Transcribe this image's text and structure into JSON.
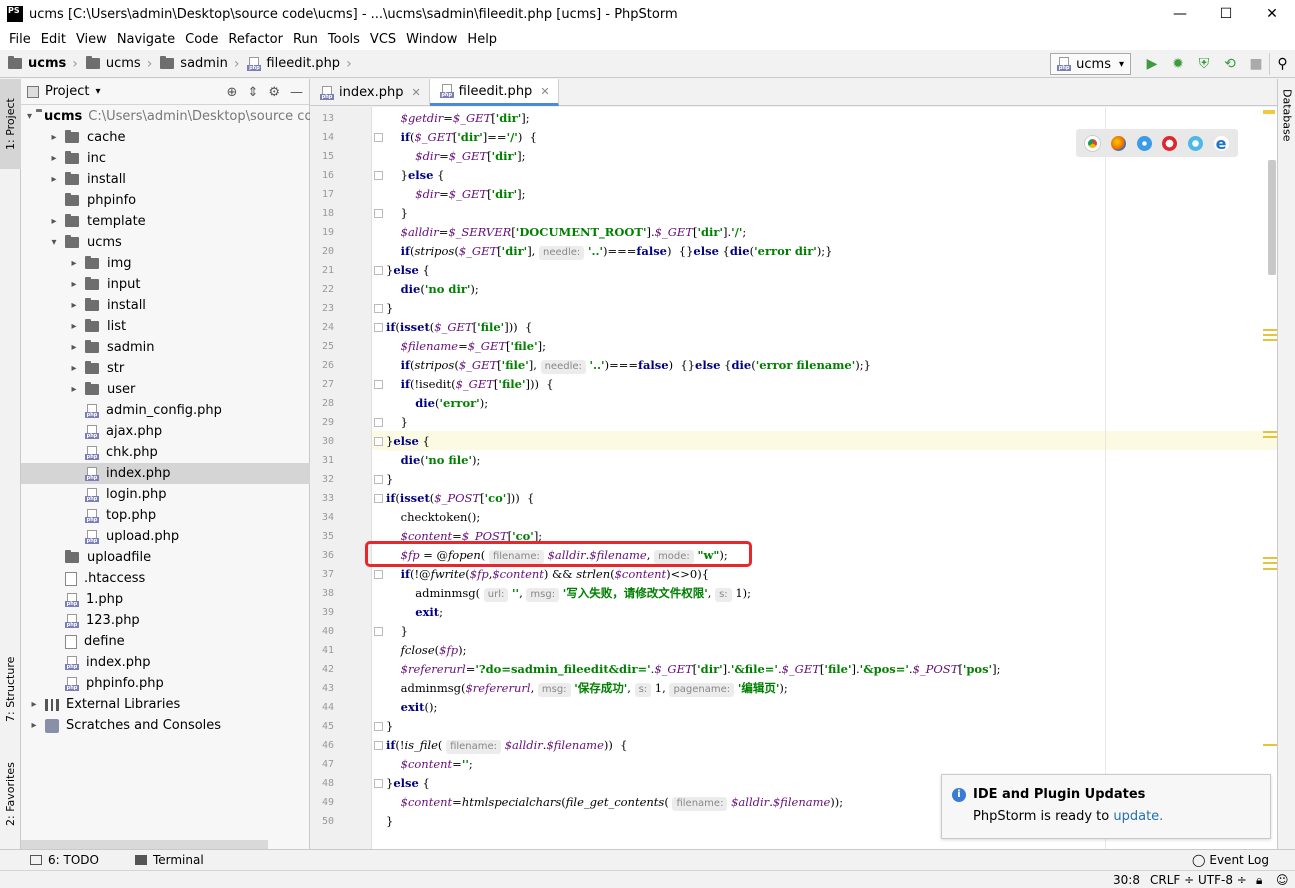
{
  "window": {
    "app_icon": "PS",
    "title": "ucms [C:\\Users\\admin\\Desktop\\source code\\ucms] - ...\\ucms\\sadmin\\fileedit.php [ucms] - PhpStorm",
    "minimize": "—",
    "maximize": "☐",
    "close": "✕"
  },
  "menu": [
    "File",
    "Edit",
    "View",
    "Navigate",
    "Code",
    "Refactor",
    "Run",
    "Tools",
    "VCS",
    "Window",
    "Help"
  ],
  "breadcrumbs": [
    "ucms",
    "ucms",
    "sadmin",
    "fileedit.php"
  ],
  "run_config": "ucms",
  "project_panel": {
    "title": "Project",
    "tree": [
      {
        "label": "ucms",
        "path": "C:\\Users\\admin\\Desktop\\source code\\ucms",
        "icon": "folder-icon",
        "depth": 0,
        "arrow": "▾",
        "bold": true
      },
      {
        "label": "cache",
        "icon": "folder-icon",
        "depth": 1,
        "arrow": "▸"
      },
      {
        "label": "inc",
        "icon": "folder-icon",
        "depth": 1,
        "arrow": "▸"
      },
      {
        "label": "install",
        "icon": "folder-icon",
        "depth": 1,
        "arrow": "▸"
      },
      {
        "label": "phpinfo",
        "icon": "folder-icon",
        "depth": 1,
        "arrow": ""
      },
      {
        "label": "template",
        "icon": "folder-icon",
        "depth": 1,
        "arrow": "▸"
      },
      {
        "label": "ucms",
        "icon": "folder-icon",
        "depth": 1,
        "arrow": "▾"
      },
      {
        "label": "img",
        "icon": "folder-icon",
        "depth": 2,
        "arrow": "▸"
      },
      {
        "label": "input",
        "icon": "folder-icon",
        "depth": 2,
        "arrow": "▸"
      },
      {
        "label": "install",
        "icon": "folder-icon",
        "depth": 2,
        "arrow": "▸"
      },
      {
        "label": "list",
        "icon": "folder-icon",
        "depth": 2,
        "arrow": "▸"
      },
      {
        "label": "sadmin",
        "icon": "folder-icon",
        "depth": 2,
        "arrow": "▸"
      },
      {
        "label": "str",
        "icon": "folder-icon",
        "depth": 2,
        "arrow": "▸"
      },
      {
        "label": "user",
        "icon": "folder-icon",
        "depth": 2,
        "arrow": "▸"
      },
      {
        "label": "admin_config.php",
        "icon": "php-file-icon",
        "depth": 2,
        "arrow": ""
      },
      {
        "label": "ajax.php",
        "icon": "php-file-icon",
        "depth": 2,
        "arrow": ""
      },
      {
        "label": "chk.php",
        "icon": "php-file-icon",
        "depth": 2,
        "arrow": ""
      },
      {
        "label": "index.php",
        "icon": "php-file-icon",
        "depth": 2,
        "arrow": "",
        "selected": true
      },
      {
        "label": "login.php",
        "icon": "php-file-icon",
        "depth": 2,
        "arrow": ""
      },
      {
        "label": "top.php",
        "icon": "php-file-icon",
        "depth": 2,
        "arrow": ""
      },
      {
        "label": "upload.php",
        "icon": "php-file-icon",
        "depth": 2,
        "arrow": ""
      },
      {
        "label": "uploadfile",
        "icon": "folder-icon",
        "depth": 1,
        "arrow": ""
      },
      {
        "label": ".htaccess",
        "icon": "htaccess-file-icon",
        "depth": 1,
        "arrow": ""
      },
      {
        "label": "1.php",
        "icon": "php-file-icon",
        "depth": 1,
        "arrow": ""
      },
      {
        "label": "123.php",
        "icon": "php-file-icon",
        "depth": 1,
        "arrow": ""
      },
      {
        "label": "define",
        "icon": "text-file-icon",
        "depth": 1,
        "arrow": ""
      },
      {
        "label": "index.php",
        "icon": "php-file-icon",
        "depth": 1,
        "arrow": ""
      },
      {
        "label": "phpinfo.php",
        "icon": "php-file-icon",
        "depth": 1,
        "arrow": ""
      },
      {
        "label": "External Libraries",
        "icon": "libraries-icon",
        "depth": 0,
        "arrow": "▸"
      },
      {
        "label": "Scratches and Consoles",
        "icon": "scratches-icon",
        "depth": 0,
        "arrow": "▸"
      }
    ]
  },
  "left_strip": {
    "project": "1: Project",
    "structure": "7: Structure",
    "favorites": "2: Favorites"
  },
  "right_strip": {
    "database": "Database"
  },
  "tabs": [
    {
      "label": "index.php",
      "active": false
    },
    {
      "label": "fileedit.php",
      "active": true
    }
  ],
  "editor": {
    "lines": [
      {
        "n": "13",
        "html": "    <span class='v'>$getdir</span>=<span class='v'>$_GET</span>[<span class='s'>'dir'</span>];"
      },
      {
        "n": "14",
        "html": "    <span class='k'>if</span>(<span class='v'>$_GET</span>[<span class='s'>'dir'</span>]==<span class='s'>'/'</span>)  {"
      },
      {
        "n": "15",
        "html": "        <span class='v'>$dir</span>=<span class='v'>$_GET</span>[<span class='s'>'dir'</span>];"
      },
      {
        "n": "16",
        "html": "    }<span class='k'>else</span> {"
      },
      {
        "n": "17",
        "html": "        <span class='v'>$dir</span>=<span class='v'>$_GET</span>[<span class='s'>'dir'</span>];"
      },
      {
        "n": "18",
        "html": "    }"
      },
      {
        "n": "19",
        "html": "    <span class='v'>$alldir</span>=<span class='v'>$_SERVER</span>[<span class='s'>'DOCUMENT_ROOT'</span>].<span class='v'>$_GET</span>[<span class='s'>'dir'</span>].<span class='s'>'/'</span>;"
      },
      {
        "n": "20",
        "html": "    <span class='k'>if</span>(<span class='f'>stripos</span>(<span class='v'>$_GET</span>[<span class='s'>'dir'</span>], <span class='hint'>needle:</span> <span class='s'>'..'</span>)===<span class='k'>false</span>)  {}<span class='k'>else</span> {<span class='k'>die</span>(<span class='s'>'error dir'</span>);}"
      },
      {
        "n": "21",
        "html": "}<span class='k'>else</span> {"
      },
      {
        "n": "22",
        "html": "    <span class='k'>die</span>(<span class='s'>'no dir'</span>);"
      },
      {
        "n": "23",
        "html": "}"
      },
      {
        "n": "24",
        "html": "<span class='k'>if</span>(<span class='k'>isset</span>(<span class='v'>$_GET</span>[<span class='s'>'file'</span>]))  {"
      },
      {
        "n": "25",
        "html": "    <span class='v'>$filename</span>=<span class='v'>$_GET</span>[<span class='s'>'file'</span>];"
      },
      {
        "n": "26",
        "html": "    <span class='k'>if</span>(<span class='f'>stripos</span>(<span class='v'>$_GET</span>[<span class='s'>'file'</span>], <span class='hint'>needle:</span> <span class='s'>'..'</span>)===<span class='k'>false</span>)  {}<span class='k'>else</span> {<span class='k'>die</span>(<span class='s'>'error filename'</span>);}"
      },
      {
        "n": "27",
        "html": "    <span class='k'>if</span>(!isedit(<span class='v'>$_GET</span>[<span class='s'>'file'</span>]))  {"
      },
      {
        "n": "28",
        "html": "        <span class='k'>die</span>(<span class='s'>'error'</span>);"
      },
      {
        "n": "29",
        "html": "    }"
      },
      {
        "n": "30",
        "html": "}<span class='k'>else</span> {",
        "current": true
      },
      {
        "n": "31",
        "html": "    <span class='k'>die</span>(<span class='s'>'no file'</span>);"
      },
      {
        "n": "32",
        "html": "}"
      },
      {
        "n": "33",
        "html": "<span class='k'>if</span>(<span class='k'>isset</span>(<span class='v'>$_POST</span>[<span class='s'>'co'</span>]))  {"
      },
      {
        "n": "34",
        "html": "    checktoken();"
      },
      {
        "n": "35",
        "html": "    <span class='v'>$content</span>=<span class='v'>$_POST</span>[<span class='s'>'co'</span>];"
      },
      {
        "n": "36",
        "html": "    <span class='v'>$fp</span> = @<span class='f'>fopen</span>( <span class='hint'>filename:</span> <span class='v'>$alldir</span>.<span class='v'>$filename</span>, <span class='hint'>mode:</span> <span class='s'>\"w\"</span>);"
      },
      {
        "n": "37",
        "html": "    <span class='k'>if</span>(!@<span class='f'>fwrite</span>(<span class='v'>$fp</span>,<span class='v'>$content</span>) &amp;&amp; <span class='f'>strlen</span>(<span class='v'>$content</span>)&lt;&gt;0){"
      },
      {
        "n": "38",
        "html": "        adminmsg( <span class='hint'>url:</span> <span class='s'>''</span>, <span class='hint'>msg:</span> <span class='s'>'写入失败，请修改文件权限'</span>, <span class='hint'>s:</span> 1);"
      },
      {
        "n": "39",
        "html": "        <span class='k'>exit</span>;"
      },
      {
        "n": "40",
        "html": "    }"
      },
      {
        "n": "41",
        "html": "    <span class='f'>fclose</span>(<span class='v'>$fp</span>);"
      },
      {
        "n": "42",
        "html": "    <span class='v'>$refererurl</span>=<span class='s'>'?do=sadmin_fileedit&amp;dir='</span>.<span class='v'>$_GET</span>[<span class='s'>'dir'</span>].<span class='s'>'&amp;file='</span>.<span class='v'>$_GET</span>[<span class='s'>'file'</span>].<span class='s'>'&amp;pos='</span>.<span class='v'>$_POST</span>[<span class='s'>'pos'</span>];"
      },
      {
        "n": "43",
        "html": "    adminmsg(<span class='v'>$refererurl</span>, <span class='hint'>msg:</span> <span class='s'>'保存成功'</span>, <span class='hint'>s:</span> 1, <span class='hint'>pagename:</span> <span class='s'>'编辑页'</span>);"
      },
      {
        "n": "44",
        "html": "    <span class='k'>exit</span>();"
      },
      {
        "n": "45",
        "html": "}"
      },
      {
        "n": "46",
        "html": "<span class='k'>if</span>(!<span class='f'>is_file</span>( <span class='hint'>filename:</span> <span class='v'>$alldir</span>.<span class='v'>$filename</span>))  {"
      },
      {
        "n": "47",
        "html": "    <span class='v'>$content</span>=<span class='s'>''</span>;"
      },
      {
        "n": "48",
        "html": "}<span class='k'>else</span> {"
      },
      {
        "n": "49",
        "html": "    <span class='v'>$content</span>=<span class='f'>htmlspecialchars</span>(<span class='f'>file_get_contents</span>( <span class='hint'>filename:</span> <span class='v'>$alldir</span>.<span class='v'>$filename</span>));"
      },
      {
        "n": "50",
        "html": "}"
      }
    ]
  },
  "notification": {
    "title": "IDE and Plugin Updates",
    "message": "PhpStorm is ready to ",
    "link": "update.",
    "icon": "info-icon"
  },
  "bottom_tools": {
    "todo": "6: TODO",
    "terminal": "Terminal",
    "event_log": "Event Log"
  },
  "status": {
    "position": "30:8",
    "line_sep": "CRLF ÷",
    "encoding": "UTF-8 ÷"
  },
  "colors": {
    "accent": "#4a89dc",
    "highlight_box": "#e8262b",
    "keyword": "#000080",
    "string": "#008000",
    "variable": "#660e7a"
  }
}
